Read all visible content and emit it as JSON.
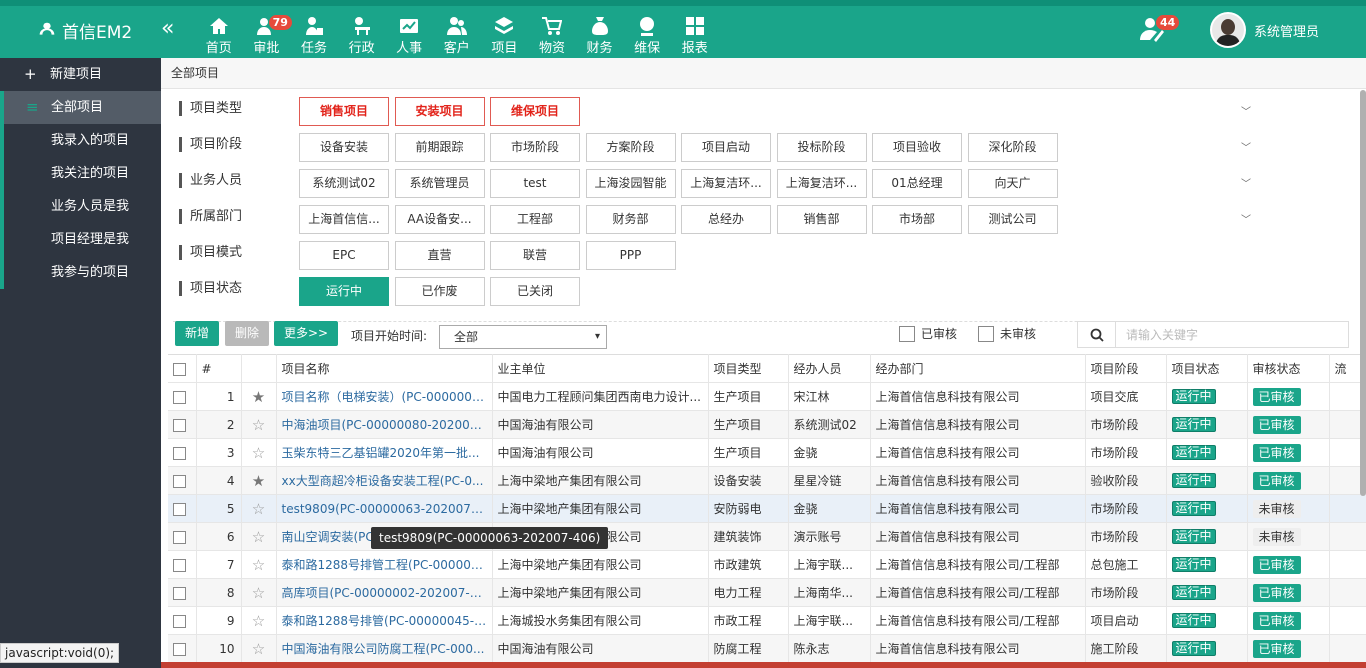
{
  "app": {
    "logo": "首信EM2"
  },
  "nav": [
    {
      "label": "首页",
      "icon": "home-icon"
    },
    {
      "label": "审批",
      "icon": "approval-icon",
      "badge": "79"
    },
    {
      "label": "任务",
      "icon": "task-icon"
    },
    {
      "label": "行政",
      "icon": "admin-icon"
    },
    {
      "label": "人事",
      "icon": "hr-icon"
    },
    {
      "label": "客户",
      "icon": "customer-icon"
    },
    {
      "label": "项目",
      "icon": "project-icon"
    },
    {
      "label": "物资",
      "icon": "cart-icon"
    },
    {
      "label": "财务",
      "icon": "finance-icon"
    },
    {
      "label": "维保",
      "icon": "maintenance-icon"
    },
    {
      "label": "报表",
      "icon": "report-icon"
    }
  ],
  "header": {
    "notify_badge": "44",
    "user_name": "系统管理员"
  },
  "sidebar": {
    "new_project": "新建项目",
    "all_projects": "全部项目",
    "items": [
      "我录入的项目",
      "我关注的项目",
      "业务人员是我",
      "项目经理是我",
      "我参与的项目"
    ]
  },
  "breadcrumb": "全部项目",
  "filters": [
    {
      "label": "项目类型",
      "options": [
        "销售项目",
        "安装项目",
        "维保项目"
      ],
      "style": "red"
    },
    {
      "label": "项目阶段",
      "options": [
        "设备安装",
        "前期跟踪",
        "市场阶段",
        "方案阶段",
        "项目启动",
        "投标阶段",
        "项目验收",
        "深化阶段"
      ]
    },
    {
      "label": "业务人员",
      "options": [
        "系统测试02",
        "系统管理员",
        "test",
        "上海浚园智能",
        "上海复洁环...",
        "上海复洁环...",
        "01总经理",
        "向天广"
      ]
    },
    {
      "label": "所属部门",
      "options": [
        "上海首信信...",
        "AA设备安...",
        "工程部",
        "财务部",
        "总经办",
        "销售部",
        "市场部",
        "测试公司"
      ]
    },
    {
      "label": "项目模式",
      "options": [
        "EPC",
        "直营",
        "联营",
        "PPP"
      ]
    },
    {
      "label": "项目状态",
      "options": [
        "运行中",
        "已作废",
        "已关闭"
      ],
      "selected": "运行中"
    }
  ],
  "toolbar": {
    "add": "新增",
    "delete": "删除",
    "more": "更多>>",
    "start_time_label": "项目开始时间:",
    "start_time_value": "全部",
    "approved": "已审核",
    "unapproved": "未审核",
    "search_placeholder": "请输入关键字"
  },
  "table": {
    "headers": [
      "#",
      "项目名称",
      "业主单位",
      "项目类型",
      "经办人员",
      "经办部门",
      "项目阶段",
      "项目状态",
      "审核状态",
      "流"
    ],
    "rows": [
      {
        "no": "1",
        "star": true,
        "name": "项目名称（电梯安装）(PC-0000008...",
        "owner": "中国电力工程顾问集团西南电力设计...",
        "type": "生产项目",
        "person": "宋江林",
        "dept": "上海首信信息科技有限公司",
        "stage": "项目交底",
        "status": "运行中",
        "audit": "已审核"
      },
      {
        "no": "2",
        "star": false,
        "name": "中海油项目(PC-00000080-202007-...",
        "owner": "中国海油有限公司",
        "type": "生产项目",
        "person": "系统测试02",
        "dept": "上海首信信息科技有限公司",
        "stage": "市场阶段",
        "status": "运行中",
        "audit": "已审核"
      },
      {
        "no": "3",
        "star": false,
        "name": "玉柴东特三乙基铝罐2020年第一批...",
        "owner": "中国海油有限公司",
        "type": "生产项目",
        "person": "金骁",
        "dept": "上海首信信息科技有限公司",
        "stage": "市场阶段",
        "status": "运行中",
        "audit": "已审核"
      },
      {
        "no": "4",
        "star": true,
        "name": "xx大型商超冷柜设备安装工程(PC-0...",
        "owner": "上海中梁地产集团有限公司",
        "type": "设备安装",
        "person": "星星冷链",
        "dept": "上海首信信息科技有限公司",
        "stage": "验收阶段",
        "status": "运行中",
        "audit": "已审核"
      },
      {
        "no": "5",
        "star": false,
        "name": "test9809(PC-00000063-202007-406)",
        "owner": "上海中梁地产集团有限公司",
        "type": "安防弱电",
        "person": "金骁",
        "dept": "上海首信信息科技有限公司",
        "stage": "市场阶段",
        "status": "运行中",
        "audit": "未审核"
      },
      {
        "no": "6",
        "star": false,
        "name": "南山空调安装(PC",
        "owner": "上海中梁地产集团有限公司",
        "type": "建筑装饰",
        "person": "演示账号",
        "dept": "上海首信信息科技有限公司",
        "stage": "市场阶段",
        "status": "运行中",
        "audit": "未审核"
      },
      {
        "no": "7",
        "star": false,
        "name": "泰和路1288号排管工程(PC-000000...",
        "owner": "上海中梁地产集团有限公司",
        "type": "市政建筑",
        "person": "上海宇联...",
        "dept": "上海首信信息科技有限公司/工程部",
        "stage": "总包施工",
        "status": "运行中",
        "audit": "已审核"
      },
      {
        "no": "8",
        "star": false,
        "name": "高库项目(PC-00000002-202007-403)",
        "owner": "上海中梁地产集团有限公司",
        "type": "电力工程",
        "person": "上海南华...",
        "dept": "上海首信信息科技有限公司/工程部",
        "stage": "市场阶段",
        "status": "运行中",
        "audit": "已审核"
      },
      {
        "no": "9",
        "star": false,
        "name": "泰和路1288号排管(PC-00000045-2...",
        "owner": "上海城投水务集团有限公司",
        "type": "市政工程",
        "person": "上海宇联...",
        "dept": "上海首信信息科技有限公司/工程部",
        "stage": "项目启动",
        "status": "运行中",
        "audit": "已审核"
      },
      {
        "no": "10",
        "star": false,
        "name": "中国海油有限公司防腐工程(PC-000...",
        "owner": "中国海油有限公司",
        "type": "防腐工程",
        "person": "陈永志",
        "dept": "上海首信信息科技有限公司",
        "stage": "施工阶段",
        "status": "运行中",
        "audit": "已审核"
      }
    ]
  },
  "tooltip": "test9809(PC-00000063-202007-406)",
  "status_url": "javascript:void(0);"
}
